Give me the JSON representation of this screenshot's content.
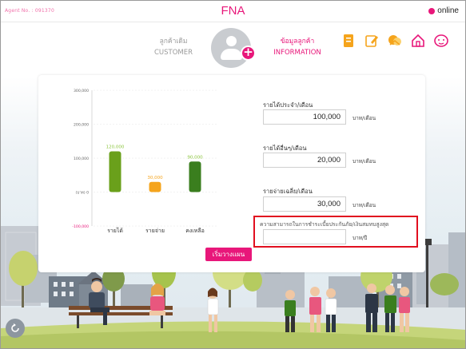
{
  "topbar": {
    "agent_no": "Agent No. : 091370",
    "title": "FNA",
    "status": "online",
    "status_color": "#e8177a"
  },
  "header": {
    "customer_tab": {
      "thai": "ลูกค้าเดิม",
      "english": "CUSTOMER"
    },
    "info_tab": {
      "thai": "ข้อมูลลูกค้า",
      "english": "INFORMATION"
    },
    "icons": [
      "document-icon",
      "edit-icon",
      "handshake-icon",
      "home-icon",
      "piggy-bank-icon"
    ]
  },
  "chart_data": {
    "type": "bar",
    "categories": [
      "รายได้",
      "รายจ่าย",
      "คงเหลือ"
    ],
    "values": [
      120000,
      30000,
      90000
    ],
    "data_labels": [
      "120,000",
      "30,000",
      "90,000"
    ],
    "colors": [
      "#6aa01b",
      "#f5a41c",
      "#3a7e1e"
    ],
    "label_colors": [
      "#8cc63e",
      "#f5a41c",
      "#8cc63e"
    ],
    "ylim": [
      -100000,
      300000
    ],
    "yticks": [
      {
        "value": 300000,
        "label": "300,000"
      },
      {
        "value": 200000,
        "label": "200,000"
      },
      {
        "value": 100000,
        "label": "100,000"
      },
      {
        "value": 0,
        "label": "(บาท) 0"
      },
      {
        "value": -100000,
        "label": "-100,000"
      }
    ]
  },
  "form": {
    "income_label": "รายได้ประจำ/เดือน",
    "income_value": "100,000",
    "income_unit": "บาท/เดือน",
    "other_income_label": "รายได้อื่นๆ/เดือน",
    "other_income_value": "20,000",
    "other_income_unit": "บาท/เดือน",
    "expense_label": "รายจ่ายเฉลี่ย/เดือน",
    "expense_value": "30,000",
    "expense_unit": "บาท/เดือน",
    "premium_label": "ความสามารถในการชำระเบี้ยประกันภัย/เงินสมทบสูงสุด",
    "premium_value": "",
    "premium_unit": "บาท/ปี"
  },
  "actions": {
    "start_plan": "เริ่มวางแผน",
    "accent": "#e8177a"
  },
  "highlight_color": "#e10f1f"
}
